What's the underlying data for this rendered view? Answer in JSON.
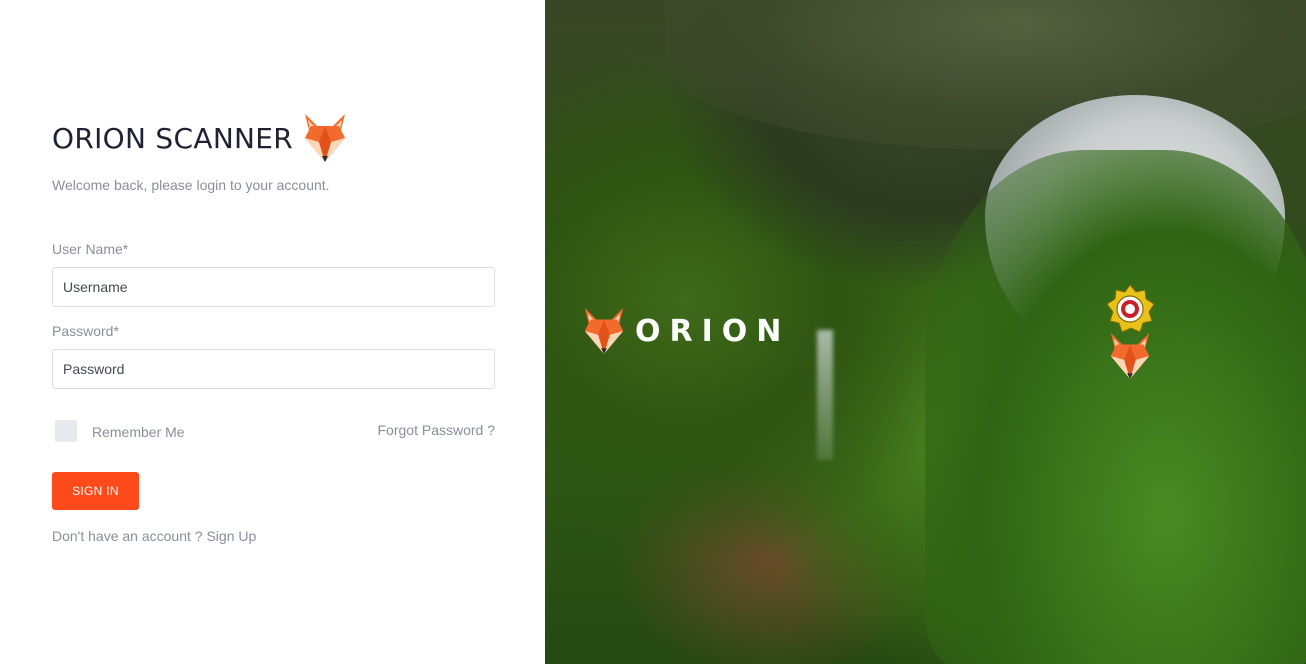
{
  "login": {
    "title": "ORION SCANNER",
    "welcome": "Welcome back, please login to your account.",
    "username_label": "User Name*",
    "username_placeholder": "Username",
    "password_label": "Password*",
    "password_placeholder": "Password",
    "remember_label": "Remember Me",
    "forgot_label": "Forgot Password ?",
    "signin_label": "SIGN IN",
    "signup_prefix": "Don't have an account ? ",
    "signup_link": "Sign Up"
  },
  "hero": {
    "brand_word": "ORION"
  },
  "icons": {
    "brand_logo": "fox-logo-icon",
    "hero_logo": "fox-logo-icon",
    "seal": "seal-emblem-icon"
  },
  "colors": {
    "accent": "#fc4a1a",
    "title": "#1f2233",
    "muted": "#8a8f9c",
    "fox_orange": "#f26b2c",
    "fox_light": "#fbd7b8"
  }
}
